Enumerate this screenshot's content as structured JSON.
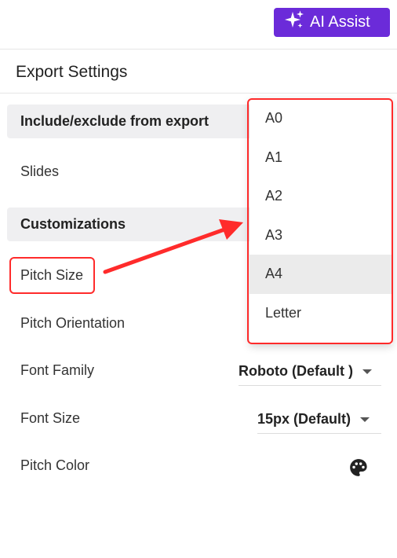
{
  "header": {
    "ai_assist_label": "AI Assist"
  },
  "panel": {
    "title": "Export Settings"
  },
  "sections": {
    "include_exclude": "Include/exclude from export",
    "customizations": "Customizations"
  },
  "rows": {
    "slides": "Slides",
    "pitch_size": "Pitch Size",
    "pitch_orientation": "Pitch Orientation",
    "font_family": "Font Family",
    "font_size": "Font Size",
    "pitch_color": "Pitch Color"
  },
  "values": {
    "font_family": "Roboto (Default )",
    "font_size": "15px (Default)"
  },
  "dropdown": {
    "options": [
      "A0",
      "A1",
      "A2",
      "A3",
      "A4",
      "Letter"
    ],
    "selected": "A4"
  },
  "icons": {
    "ai": "sparkles-icon",
    "palette": "palette-icon",
    "caret": "chevron-down-icon"
  },
  "colors": {
    "accent": "#6b2bd9",
    "highlight": "#ff2b2b"
  }
}
